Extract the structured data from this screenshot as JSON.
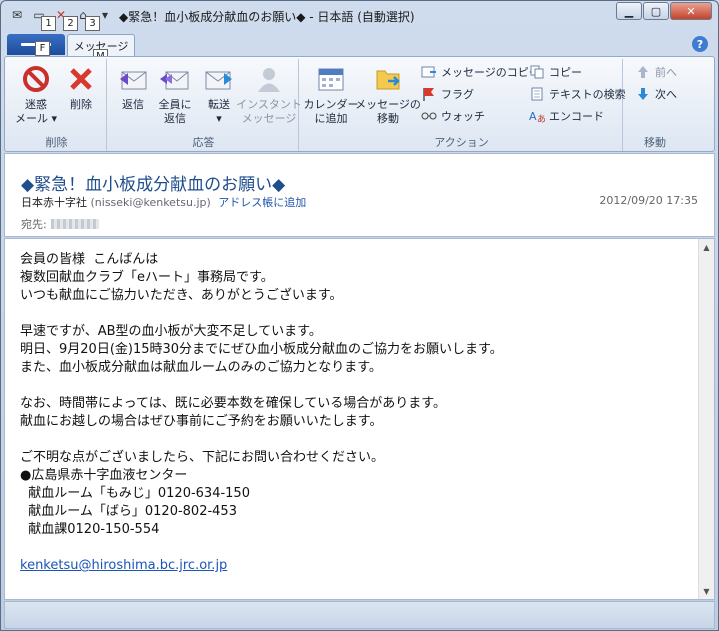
{
  "window": {
    "title": "◆緊急！血小板成分献血のお願い◆ - 日本語 (自動選択)",
    "keytips": {
      "qat1": "1",
      "qat2": "2",
      "qat3": "3",
      "file": "F",
      "message": "M"
    }
  },
  "tabs": {
    "message": "メッセージ"
  },
  "ribbon": {
    "groups": {
      "delete": "削除",
      "respond": "応答",
      "actions": "アクション",
      "move": "移動"
    },
    "junk": "迷惑\nメール ▾",
    "delete": "削除",
    "reply": "返信",
    "reply_all": "全員に\n返信",
    "forward": "転送\n▾",
    "im": "インスタント\nメッセージ",
    "calendar": "カレンダー\nに追加",
    "move_msg": "メッセージの\n移動",
    "copy_msg": "メッセージのコピー",
    "flag": "フラグ",
    "watch": "ウォッチ",
    "copy": "コピー",
    "find_text": "テキストの検索",
    "encode": "エンコード",
    "prev": "前へ",
    "next": "次へ"
  },
  "header": {
    "subject": "◆緊急！血小板成分献血のお願い◆",
    "from_name": "日本赤十字社",
    "from_addr": "(nisseki@kenketsu.jp)",
    "add_to_book": "アドレス帳に追加",
    "datetime": "2012/09/20 17:35",
    "to_label": "宛先:"
  },
  "body": {
    "para1": [
      "会員の皆様  こんばんは",
      "複数回献血クラブ「eハート」事務局です。",
      "いつも献血にご協力いただき、ありがとうございます。"
    ],
    "para2": [
      "早速ですが、AB型の血小板が大変不足しています。",
      "明日、9月20日(金)15時30分までにぜひ血小板成分献血のご協力をお願いします。",
      "また、血小板成分献血は献血ルームのみのご協力となります。"
    ],
    "para3": [
      "なお、時間帯によっては、既に必要本数を確保している場合があります。",
      "献血にお越しの場合はぜひ事前にご予約をお願いいたします。"
    ],
    "para4": [
      "ご不明な点がございましたら、下記にお問い合わせください。",
      "●広島県赤十字血液センター",
      "  献血ルーム「もみじ」0120-634-150",
      "  献血ルーム「ばら」0120-802-453",
      "  献血課0120-150-554"
    ],
    "link": "kenketsu@hiroshima.bc.jrc.or.jp"
  },
  "colors": {
    "accent": "#1f4e8c",
    "file_tab": "#2a5db0",
    "link": "#1a55b8"
  }
}
